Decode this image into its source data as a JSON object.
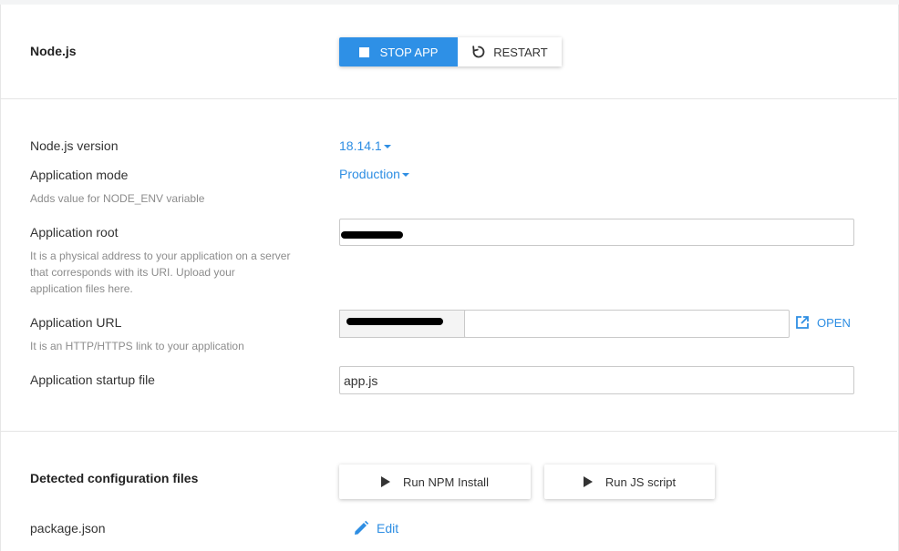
{
  "header": {
    "title": "Node.js",
    "stop_label": "STOP APP",
    "restart_label": "RESTART"
  },
  "settings": {
    "version_label": "Node.js version",
    "version_value": "18.14.1",
    "mode_label": "Application mode",
    "mode_value": "Production",
    "mode_hint": "Adds value for NODE_ENV variable",
    "root_label": "Application root",
    "root_hint_1": "It is a physical address to your application on a server",
    "root_hint_2": "that corresponds with its URI. Upload your",
    "root_hint_3": "application files here.",
    "url_label": "Application URL",
    "url_hint": "It is an HTTP/HTTPS link to your application",
    "open_label": "OPEN",
    "startup_label": "Application startup file",
    "startup_value": "app.js"
  },
  "config": {
    "title": "Detected configuration files",
    "npm_label": "Run NPM Install",
    "js_label": "Run JS script",
    "file_name": "package.json",
    "edit_label": "Edit"
  },
  "colors": {
    "accent": "#2e90e6",
    "link": "#2e8ee3"
  },
  "icons": [
    "stop-icon",
    "restart-icon",
    "caret-down-icon",
    "external-link-icon",
    "play-icon",
    "pencil-icon"
  ]
}
